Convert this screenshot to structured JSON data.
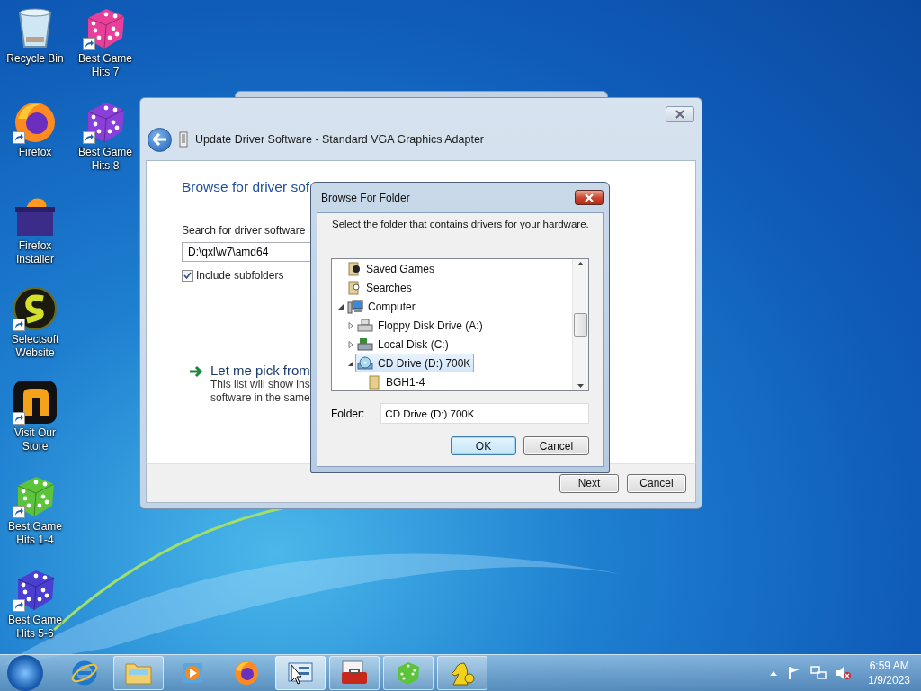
{
  "desktop_icons": [
    {
      "label": "Recycle Bin",
      "kind": "bin",
      "shortcut": false
    },
    {
      "label": "Firefox",
      "kind": "firefox",
      "shortcut": true
    },
    {
      "label": "Firefox Installer",
      "kind": "installer",
      "shortcut": false
    },
    {
      "label": "Selectsoft Website",
      "kind": "selectsoft",
      "shortcut": true
    },
    {
      "label": "Visit Our Store",
      "kind": "store",
      "shortcut": true
    },
    {
      "label": "Best Game Hits 1-4",
      "kind": "dice",
      "color": "#5cc43a",
      "shortcut": true
    },
    {
      "label": "Best Game Hits 5-6",
      "kind": "dice",
      "color": "#4a3fd0",
      "shortcut": true
    },
    {
      "label": "Best Game Hits 7",
      "kind": "dice",
      "color": "#e8409a",
      "shortcut": true
    },
    {
      "label": "Best Game Hits 8",
      "kind": "dice",
      "color": "#8a3fd8",
      "shortcut": true
    }
  ],
  "wizard": {
    "title": "Update Driver Software - Standard VGA Graphics Adapter",
    "heading": "Browse for driver sof",
    "search_label": "Search for driver software",
    "path": "D:\\qxl\\w7\\amd64",
    "include_subfolders": {
      "label": "Include subfolders",
      "checked": true
    },
    "pick_link": "Let me pick from",
    "pick_description": [
      "This list will show ins",
      "software in the same"
    ],
    "buttons": [
      "Next",
      "Cancel"
    ]
  },
  "dialog": {
    "title": "Browse For Folder",
    "prompt": "Select the folder that contains drivers for your hardware.",
    "tree": [
      {
        "label": "Saved Games",
        "kind": "games",
        "selected": false
      },
      {
        "label": "Searches",
        "kind": "searches",
        "selected": false
      },
      {
        "label": "Computer",
        "kind": "computer",
        "selected": false,
        "expanded": true,
        "children": [
          {
            "label": "Floppy Disk Drive (A:)",
            "kind": "floppy",
            "selected": false,
            "expanded": false
          },
          {
            "label": "Local Disk (C:)",
            "kind": "disk",
            "selected": false,
            "expanded": false
          },
          {
            "label": "CD Drive (D:) 700K",
            "kind": "cd",
            "selected": true,
            "expanded": true,
            "children": [
              {
                "label": "BGH1-4",
                "kind": "folder",
                "selected": false
              }
            ]
          }
        ]
      }
    ],
    "folder_label": "Folder:",
    "folder_value": "CD Drive (D:) 700K",
    "buttons": [
      {
        "label": "OK",
        "default": true
      },
      {
        "label": "Cancel",
        "default": false
      }
    ]
  },
  "taskbar": {
    "items": [
      {
        "kind": "ie",
        "running": false,
        "selected": false
      },
      {
        "kind": "explorer",
        "running": true,
        "selected": false
      },
      {
        "kind": "media",
        "running": false,
        "selected": false
      },
      {
        "kind": "firefox",
        "running": false,
        "selected": false
      },
      {
        "kind": "devices",
        "running": true,
        "selected": true
      },
      {
        "kind": "toolbox",
        "running": true,
        "selected": false
      },
      {
        "kind": "dice",
        "running": true,
        "selected": false
      },
      {
        "kind": "knight",
        "running": true,
        "selected": false
      }
    ],
    "time": "6:59 AM",
    "date": "1/9/2023"
  }
}
